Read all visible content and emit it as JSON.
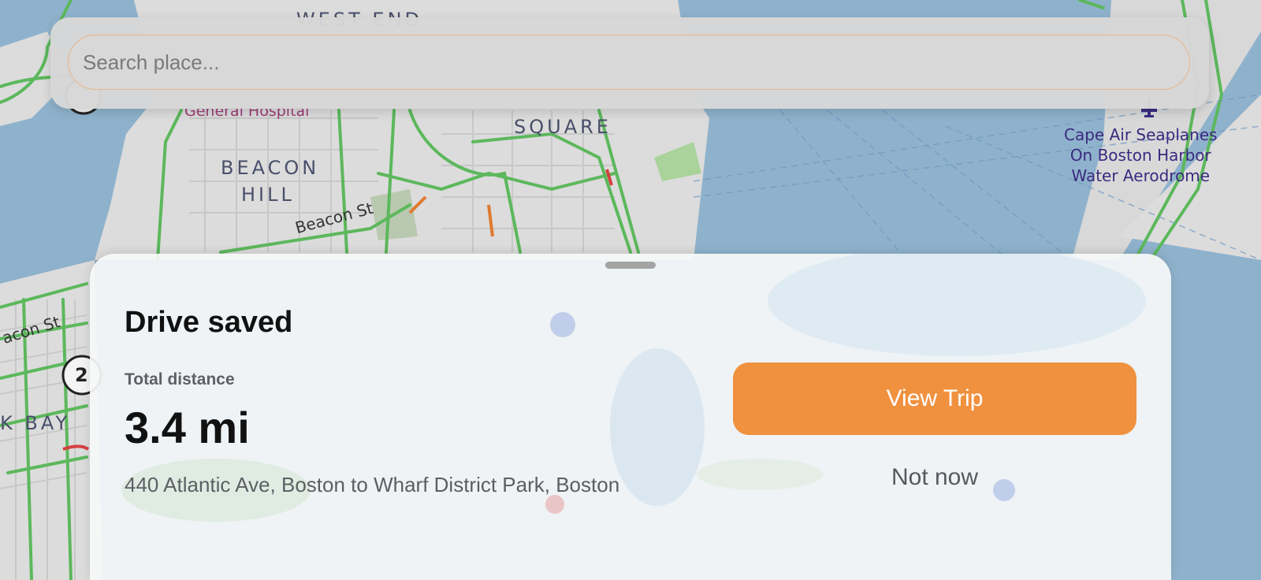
{
  "map": {
    "labels": {
      "west_end": "WEST END",
      "general_hospital": "General Hospital",
      "square": "SQUARE",
      "beacon_hill_1": "BEACON",
      "beacon_hill_2": "HILL",
      "beacon_st_1": "Beacon St",
      "beacon_st_2": "acon St",
      "back_bay": "K BAY",
      "route_number": "2",
      "poi_line1": "Cape Air Seaplanes",
      "poi_line2": "On Boston Harbor",
      "poi_line3": "Water Aerodrome"
    },
    "icons": [
      "airport-icon",
      "route-shield-icon"
    ]
  },
  "search": {
    "placeholder": "Search place..."
  },
  "sheet": {
    "title": "Drive saved",
    "distance_label": "Total distance",
    "distance_value": "3.4 mi",
    "route_text": "440 Atlantic Ave, Boston to Wharf District Park, Boston",
    "primary_action": "View Trip",
    "secondary_action": "Not now"
  },
  "colors": {
    "accent": "#f0913f",
    "water": "#8fb2cc",
    "land": "#dcdcdc",
    "traffic_road": "#5cb85c",
    "search_border": "#e8b58a"
  }
}
